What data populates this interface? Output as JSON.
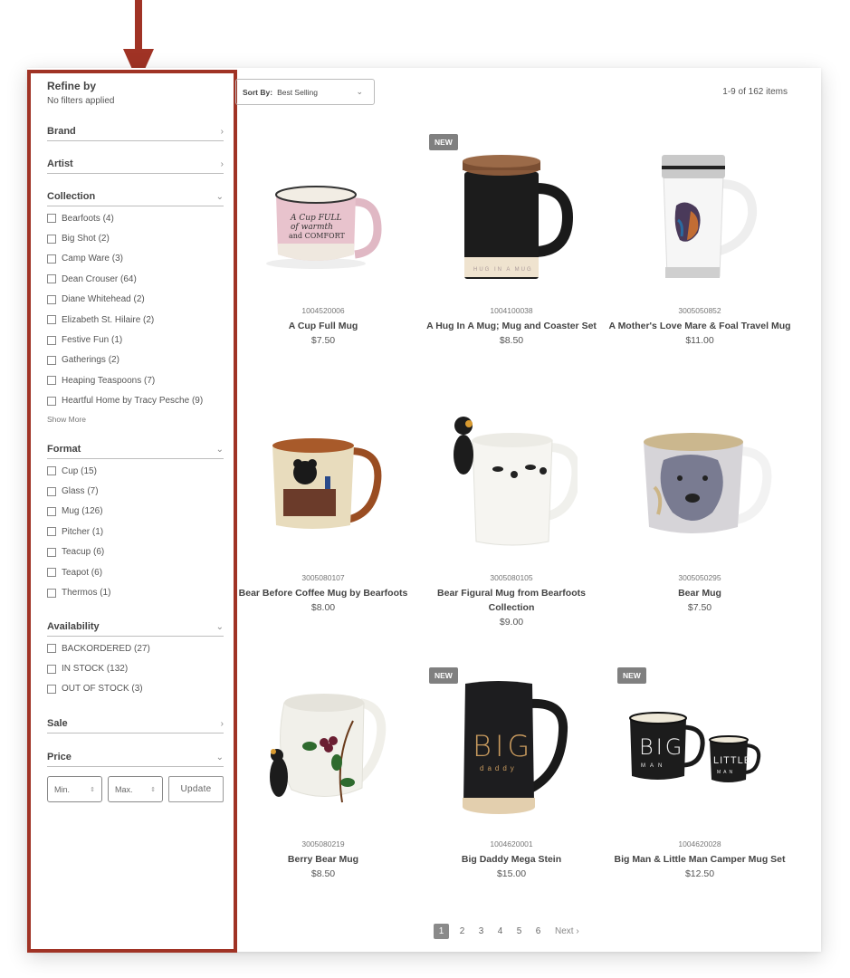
{
  "annotation": {
    "color": "#a03325",
    "target": "refine-by sidebar"
  },
  "sidebar": {
    "title": "Refine by",
    "subtitle": "No filters applied",
    "facets": [
      {
        "label": "Brand",
        "state": "collapsed",
        "icon": "chevron-right-icon",
        "glyph": "›"
      },
      {
        "label": "Artist",
        "state": "collapsed",
        "icon": "chevron-right-icon",
        "glyph": "›"
      },
      {
        "label": "Collection",
        "state": "expanded",
        "icon": "chevron-down-icon",
        "glyph": "⌄",
        "options": [
          "Bearfoots (4)",
          "Big Shot (2)",
          "Camp Ware (3)",
          "Dean Crouser (64)",
          "Diane Whitehead (2)",
          "Elizabeth St. Hilaire (2)",
          "Festive Fun (1)",
          "Gatherings (2)",
          "Heaping Teaspoons (7)",
          "Heartful Home by Tracy Pesche (9)"
        ],
        "show_more": "Show More"
      },
      {
        "label": "Format",
        "state": "expanded",
        "icon": "chevron-down-icon",
        "glyph": "⌄",
        "options": [
          "Cup (15)",
          "Glass (7)",
          "Mug (126)",
          "Pitcher (1)",
          "Teacup (6)",
          "Teapot (6)",
          "Thermos (1)"
        ]
      },
      {
        "label": "Availability",
        "state": "expanded",
        "icon": "chevron-down-icon",
        "glyph": "⌄",
        "options": [
          "BACKORDERED (27)",
          "IN STOCK (132)",
          "OUT OF STOCK (3)"
        ]
      },
      {
        "label": "Sale",
        "state": "collapsed",
        "icon": "chevron-right-icon",
        "glyph": "›"
      },
      {
        "label": "Price",
        "state": "expanded",
        "icon": "chevron-down-icon",
        "glyph": "⌄"
      }
    ],
    "price": {
      "min_placeholder": "Min.",
      "max_placeholder": "Max.",
      "spinner_glyph": "⇕",
      "update_label": "Update"
    }
  },
  "toolbar": {
    "sort_label": "Sort By:",
    "sort_value": "Best Selling",
    "sort_chevron": "⌄",
    "item_count": "1-9 of 162 items"
  },
  "products": [
    {
      "sku": "1004520006",
      "name": "A Cup Full Mug",
      "price": "$7.50",
      "badge": null,
      "image": "pink camp mug 'A Cup Full of Warmth and Comfort'"
    },
    {
      "sku": "1004100038",
      "name": "A Hug In A Mug; Mug and Coaster Set",
      "price": "$8.50",
      "badge": "NEW",
      "image": "black mug with wooden coaster lid"
    },
    {
      "sku": "3005050852",
      "name": "A Mother's Love Mare & Foal Travel Mug",
      "price": "$11.00",
      "badge": null,
      "image": "white travel mug with watercolor horses"
    },
    {
      "sku": "3005080107",
      "name": "Bear Before Coffee Mug by Bearfoots",
      "price": "$8.00",
      "badge": null,
      "image": "tan mug with bear at desk"
    },
    {
      "sku": "3005080105",
      "name": "Bear Figural Mug from Bearfoots Collection",
      "price": "$9.00",
      "badge": null,
      "image": "white mug with climbing bear figure and paw prints"
    },
    {
      "sku": "3005050295",
      "name": "Bear Mug",
      "price": "$7.50",
      "badge": null,
      "image": "watercolor bear face mug"
    },
    {
      "sku": "3005080219",
      "name": "Berry Bear Mug",
      "price": "$8.50",
      "badge": null,
      "image": "white mug with berries and bear figure"
    },
    {
      "sku": "1004620001",
      "name": "Big Daddy Mega Stein",
      "price": "$15.00",
      "badge": "NEW",
      "image": "tall black stein 'BIG daddy'"
    },
    {
      "sku": "1004620028",
      "name": "Big Man & Little Man Camper Mug Set",
      "price": "$12.50",
      "badge": "NEW",
      "image": "two black enamel camper mugs"
    }
  ],
  "pagination": {
    "pages": [
      "1",
      "2",
      "3",
      "4",
      "5",
      "6"
    ],
    "current": "1",
    "next_label": "Next",
    "next_glyph": "›"
  }
}
